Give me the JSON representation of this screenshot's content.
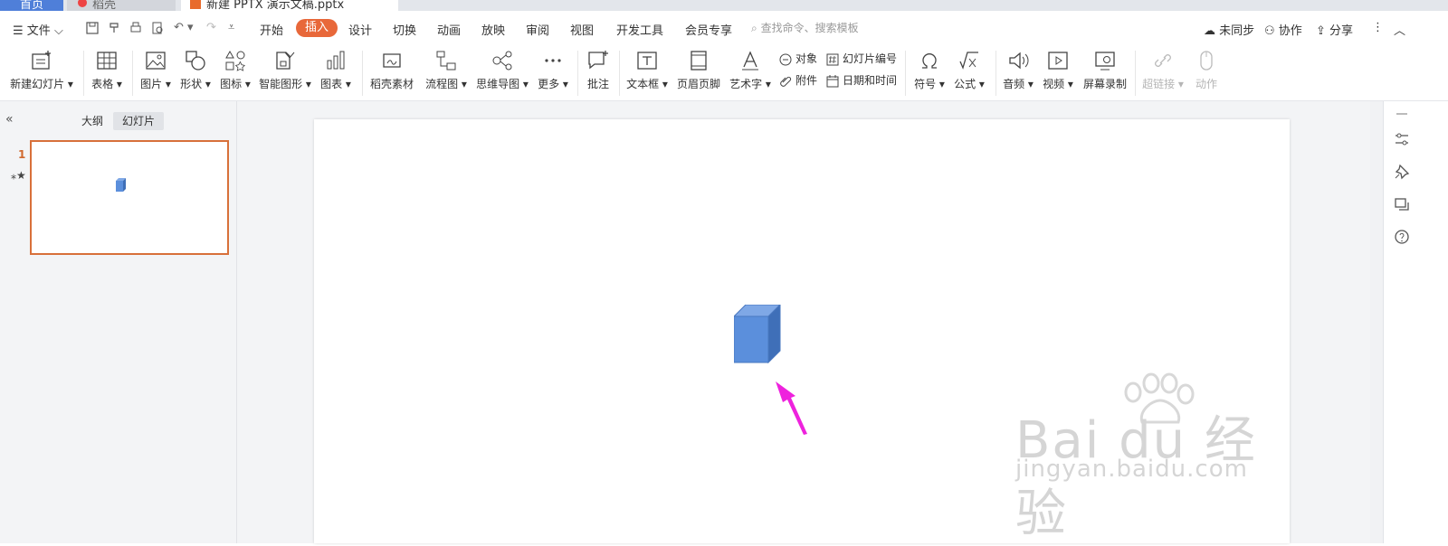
{
  "tabs": {
    "home": "首页",
    "doc1": "稻壳",
    "active": "新建 PPTX 演示文稿.pptx"
  },
  "menu": {
    "file": "文件",
    "items": [
      "开始",
      "插入",
      "设计",
      "切换",
      "动画",
      "放映",
      "审阅",
      "视图",
      "开发工具",
      "会员专享"
    ],
    "active": "插入",
    "search_placeholder": "查找命令、搜索模板",
    "sync": "未同步",
    "collab": "协作",
    "share": "分享"
  },
  "ribbon": {
    "new_slide": "新建幻灯片",
    "table": "表格",
    "image": "图片",
    "shape": "形状",
    "icon": "图标",
    "smartart": "智能图形",
    "chart": "图表",
    "material": "稻壳素材",
    "flowchart": "流程图",
    "mindmap": "思维导图",
    "more": "更多",
    "comment": "批注",
    "textbox": "文本框",
    "header_footer": "页眉页脚",
    "wordart": "艺术字",
    "object": "对象",
    "attachment": "附件",
    "slide_number": "幻灯片编号",
    "datetime": "日期和时间",
    "symbol": "符号",
    "formula": "公式",
    "audio": "音频",
    "video": "视频",
    "screen_record": "屏幕录制",
    "hyperlink": "超链接",
    "action": "动作"
  },
  "left_panel": {
    "outline_tab": "大纲",
    "slides_tab": "幻灯片",
    "slide_number": "1"
  },
  "watermark": {
    "brand": "Bai du 经验",
    "url": "jingyan.baidu.com"
  },
  "colors": {
    "accent": "#e8683a",
    "cube_front": "#5b8fdc",
    "cube_top": "#7fa8e6",
    "cube_side": "#3f6fb8",
    "arrow": "#ee22dd"
  }
}
